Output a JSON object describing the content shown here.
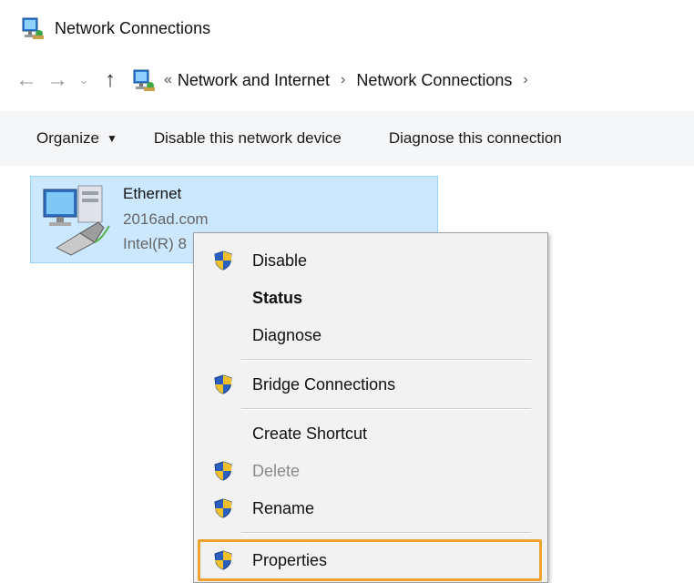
{
  "window": {
    "title": "Network Connections",
    "icon": "network-connections-icon"
  },
  "address_bar": {
    "back_icon": "arrow-left-icon",
    "forward_icon": "arrow-right-icon",
    "up_icon": "arrow-up-icon",
    "overflow": "«",
    "crumbs": [
      "Network and Internet",
      "Network Connections"
    ]
  },
  "command_bar": {
    "organize": "Organize",
    "disable": "Disable this network device",
    "diagnose": "Diagnose this connection"
  },
  "connection": {
    "name": "Ethernet",
    "domain": "2016ad.com",
    "adapter": "Intel(R) 8"
  },
  "context_menu": {
    "disable": "Disable",
    "status": "Status",
    "diagnose": "Diagnose",
    "bridge": "Bridge Connections",
    "shortcut": "Create Shortcut",
    "delete": "Delete",
    "rename": "Rename",
    "properties": "Properties"
  },
  "colors": {
    "selection": "#cce8ff",
    "highlight": "#f0a22e",
    "menu_bg": "#f2f2f2"
  }
}
